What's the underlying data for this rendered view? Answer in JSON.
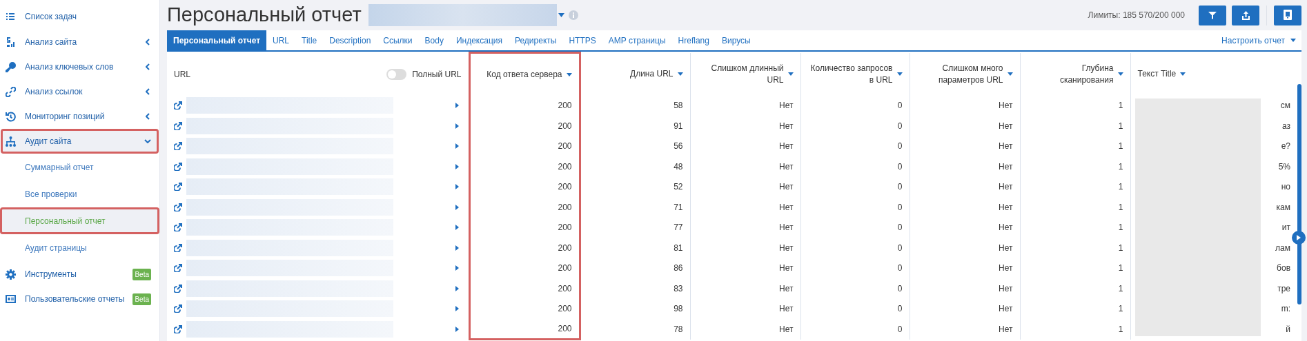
{
  "sidebar": {
    "items": [
      {
        "label": "Список задач",
        "kind": "plain",
        "selected": false,
        "highlighted": false
      },
      {
        "label": "Анализ сайта",
        "kind": "group",
        "expanded": false,
        "selected": false,
        "highlighted": false
      },
      {
        "label": "Анализ ключевых слов",
        "kind": "group",
        "expanded": false,
        "selected": false,
        "highlighted": false
      },
      {
        "label": "Анализ ссылок",
        "kind": "group",
        "expanded": false,
        "selected": false,
        "highlighted": false
      },
      {
        "label": "Мониторинг позиций",
        "kind": "group",
        "expanded": false,
        "selected": false,
        "highlighted": false
      },
      {
        "label": "Аудит сайта",
        "kind": "group",
        "expanded": true,
        "selected": false,
        "highlighted": true,
        "children": [
          {
            "label": "Суммарный отчет",
            "selected": false,
            "highlighted": false
          },
          {
            "label": "Все проверки",
            "selected": false,
            "highlighted": false
          },
          {
            "label": "Персональный отчет",
            "selected": true,
            "highlighted": true
          },
          {
            "label": "Аудит страницы",
            "selected": false,
            "highlighted": false
          }
        ]
      },
      {
        "label": "Инструменты",
        "kind": "beta",
        "badge": "Beta",
        "selected": false,
        "highlighted": false
      },
      {
        "label": "Пользовательские отчеты",
        "kind": "beta",
        "badge": "Beta",
        "selected": false,
        "highlighted": false
      }
    ]
  },
  "header": {
    "title": "Персональный отчет",
    "limits": "Лимиты: 185 570/200 000"
  },
  "tabs": [
    {
      "label": "Персональный отчет",
      "selected": true
    },
    {
      "label": "URL",
      "selected": false
    },
    {
      "label": "Title",
      "selected": false
    },
    {
      "label": "Description",
      "selected": false
    },
    {
      "label": "Ссылки",
      "selected": false
    },
    {
      "label": "Body",
      "selected": false
    },
    {
      "label": "Индексация",
      "selected": false
    },
    {
      "label": "Редиректы",
      "selected": false
    },
    {
      "label": "HTTPS",
      "selected": false
    },
    {
      "label": "AMP страницы",
      "selected": false
    },
    {
      "label": "Hreflang",
      "selected": false
    },
    {
      "label": "Вирусы",
      "selected": false
    }
  ],
  "configure": "Настроить отчет",
  "table": {
    "url_header": "URL",
    "full_url_toggle": {
      "label": "Полный URL",
      "on": false
    },
    "columns": [
      {
        "label": "Код ответа сервера",
        "highlighted": true
      },
      {
        "label": "Длина URL",
        "highlighted": false
      },
      {
        "label": "Слишком длинный URL",
        "highlighted": false
      },
      {
        "label": "Количество запросов в URL",
        "highlighted": false
      },
      {
        "label": "Слишком много параметров URL",
        "highlighted": false
      },
      {
        "label": "Глубина сканирования",
        "highlighted": false
      },
      {
        "label": "Текст Title",
        "highlighted": false
      }
    ],
    "rows": [
      [
        "200",
        "58",
        "Нет",
        "0",
        "Нет",
        "1",
        "см"
      ],
      [
        "200",
        "91",
        "Нет",
        "0",
        "Нет",
        "1",
        "аз"
      ],
      [
        "200",
        "56",
        "Нет",
        "0",
        "Нет",
        "1",
        "е?"
      ],
      [
        "200",
        "48",
        "Нет",
        "0",
        "Нет",
        "1",
        "5%"
      ],
      [
        "200",
        "52",
        "Нет",
        "0",
        "Нет",
        "1",
        "но"
      ],
      [
        "200",
        "71",
        "Нет",
        "0",
        "Нет",
        "1",
        "кам"
      ],
      [
        "200",
        "77",
        "Нет",
        "0",
        "Нет",
        "1",
        "ит"
      ],
      [
        "200",
        "81",
        "Нет",
        "0",
        "Нет",
        "1",
        "лам"
      ],
      [
        "200",
        "86",
        "Нет",
        "0",
        "Нет",
        "1",
        "бов"
      ],
      [
        "200",
        "83",
        "Нет",
        "0",
        "Нет",
        "1",
        "тре"
      ],
      [
        "200",
        "98",
        "Нет",
        "0",
        "Нет",
        "1",
        "m:"
      ],
      [
        "200",
        "78",
        "Нет",
        "0",
        "Нет",
        "1",
        "й"
      ]
    ]
  }
}
